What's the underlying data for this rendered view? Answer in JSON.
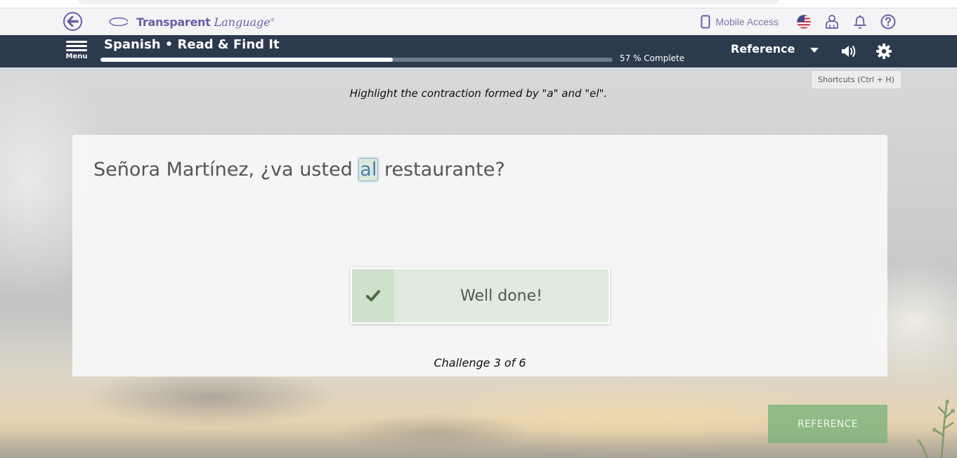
{
  "header": {
    "logo": {
      "bold": "Transparent",
      "italic": "Language",
      "registered": "®"
    },
    "mobile_access_label": "Mobile Access",
    "icons": [
      "back-arrow-icon",
      "phone-icon",
      "us-flag-icon",
      "user-icon",
      "bell-icon",
      "help-icon"
    ]
  },
  "navbar": {
    "menu_label": "Menu",
    "title": "Spanish • Read & Find It",
    "progress": {
      "percent": 57,
      "label": "57 % Complete"
    },
    "reference_label": "Reference",
    "icons": [
      "menu-icon",
      "caret-down-icon",
      "speaker-icon",
      "gear-icon"
    ]
  },
  "tooltip": {
    "shortcuts": "Shortcuts (Ctrl + H)"
  },
  "exercise": {
    "instruction": "Highlight the contraction formed by \"a\" and \"el\".",
    "sentence_words": [
      "Señora",
      "Martínez,",
      "¿va",
      "usted",
      "al",
      "restaurante?"
    ],
    "highlighted_index": 4,
    "feedback": {
      "text": "Well done!",
      "icon": "checkmark-icon"
    },
    "challenge": "Challenge 3 of 6"
  },
  "footer": {
    "reference_button": "REFERENCE"
  },
  "colors": {
    "brand_purple": "#6b5ea8",
    "navbar": "#2c3a4e",
    "success_bg": "#e1eadf",
    "success_text": "#4d5e48",
    "reference_button": "#7ab278"
  }
}
